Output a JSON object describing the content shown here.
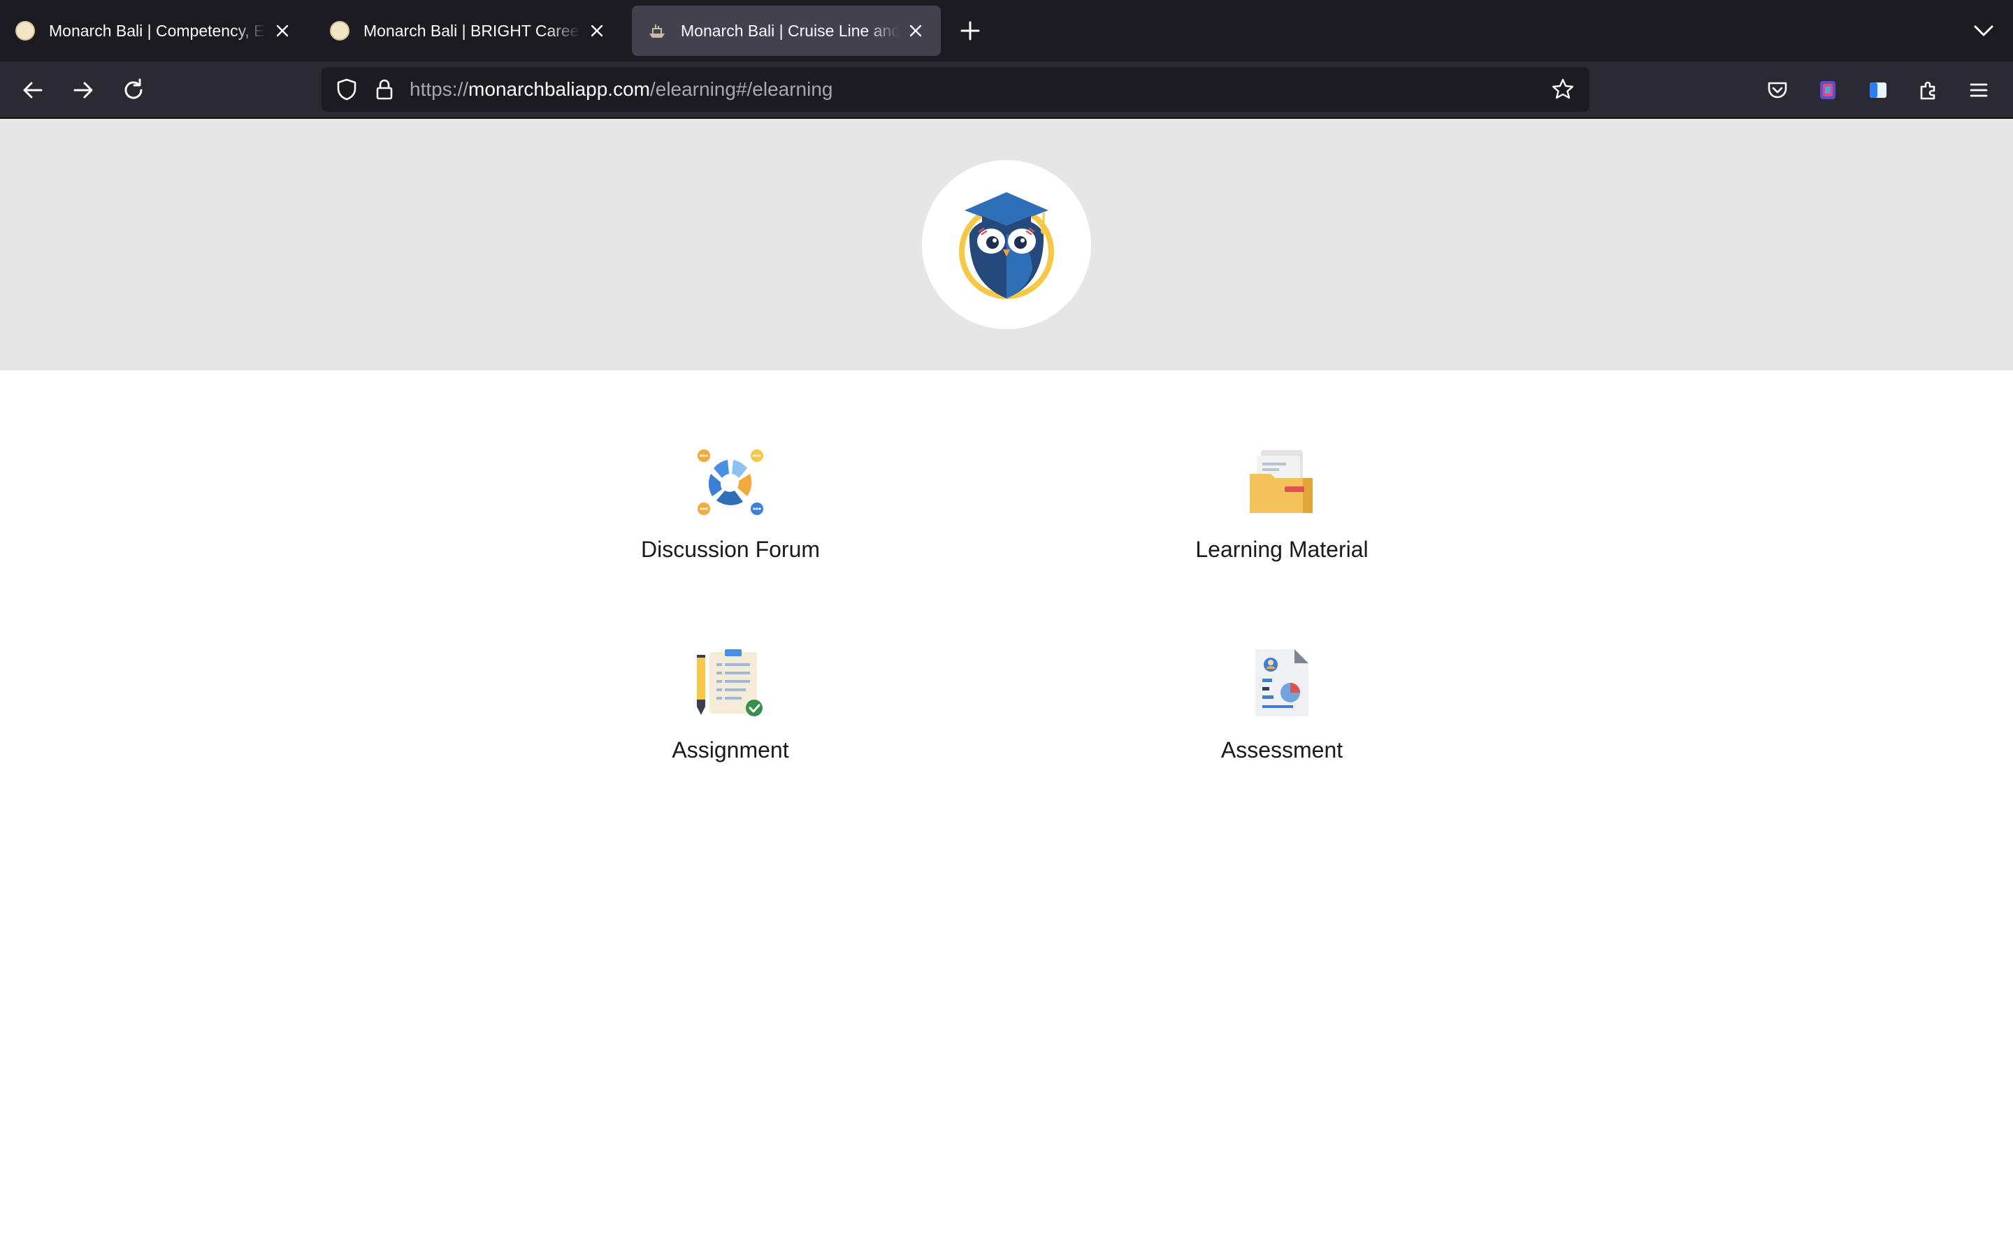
{
  "browser": {
    "tabs": [
      {
        "title": "Monarch Bali | Competency, Entry",
        "favicon": "owl-favicon-icon",
        "active": false
      },
      {
        "title": "Monarch Bali | BRIGHT Career Mgmt",
        "favicon": "owl-favicon-icon",
        "active": false
      },
      {
        "title": "Monarch Bali | Cruise Line and Hotel",
        "favicon": "ship-favicon-icon",
        "active": true
      }
    ],
    "url": {
      "scheme": "https://",
      "host": "monarchbaliapp.com",
      "path": "/elearning#/elearning"
    }
  },
  "page": {
    "logo": "owl-graduate-logo",
    "menu": [
      {
        "label": "Discussion Forum",
        "icon": "discussion-forum-icon"
      },
      {
        "label": "Learning Material",
        "icon": "folder-icon"
      },
      {
        "label": "Assignment",
        "icon": "assignment-icon"
      },
      {
        "label": "Assessment",
        "icon": "assessment-icon"
      }
    ]
  }
}
